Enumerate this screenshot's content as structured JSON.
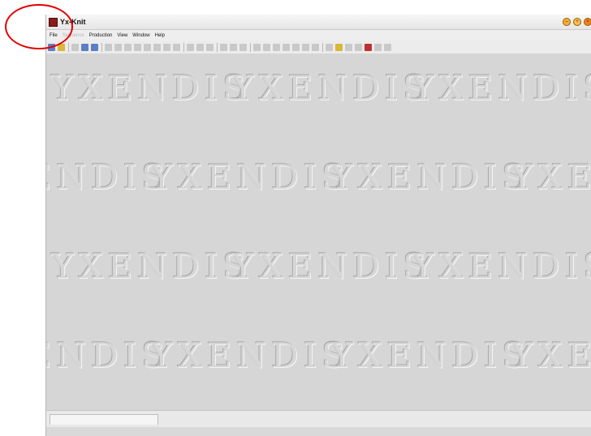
{
  "window": {
    "title": "Yx-Knit",
    "buttons": [
      "–",
      "+",
      "×"
    ]
  },
  "menu": {
    "items": [
      {
        "label": "File",
        "enabled": true
      },
      {
        "label": "Sequence",
        "enabled": false
      },
      {
        "label": "Production",
        "enabled": true
      },
      {
        "label": "View",
        "enabled": true
      },
      {
        "label": "Window",
        "enabled": true
      },
      {
        "label": "Help",
        "enabled": true
      }
    ]
  },
  "watermark": {
    "text": "YXENDIS"
  },
  "colors": {
    "annotation": "#e00000",
    "background": "#d6d6d6"
  }
}
